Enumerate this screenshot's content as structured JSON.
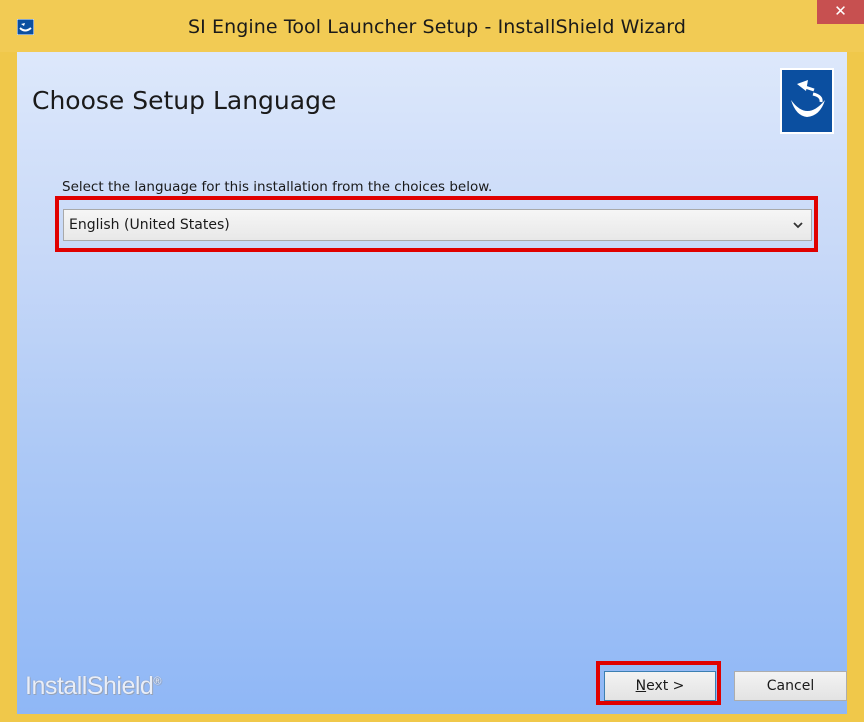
{
  "window": {
    "title": "SI Engine Tool Launcher Setup - InstallShield Wizard",
    "close_glyph": "✕"
  },
  "header": {
    "title": "Choose Setup Language",
    "logo_icon": "installshield-logo-icon"
  },
  "language": {
    "prompt": "Select the language for this installation from the choices below.",
    "selected": "English (United States)"
  },
  "footer": {
    "brand": "InstallShield",
    "brand_mark": "®",
    "next_mnemonic": "N",
    "next_rest": "ext >",
    "cancel_label": "Cancel"
  },
  "colors": {
    "titlebar": "#f2cb54",
    "close": "#c75050",
    "highlight": "#e00000",
    "logo": "#0b4fa0"
  }
}
